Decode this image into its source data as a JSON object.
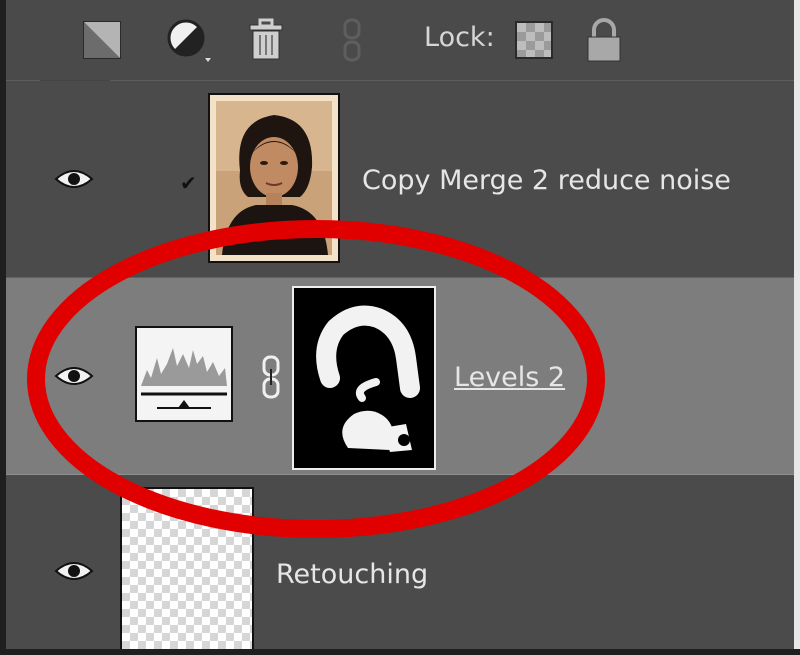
{
  "toolbar": {
    "lock_label": "Lock:",
    "icons": [
      "new-layer-icon",
      "adjustment-layer-icon",
      "delete-layer-icon",
      "link-layers-icon",
      "lock-transparent-icon",
      "lock-all-icon"
    ]
  },
  "layers": [
    {
      "name": "Copy Merge 2 reduce noise",
      "visible": true,
      "selected": false
    },
    {
      "name": "Levels 2",
      "visible": true,
      "selected": true
    },
    {
      "name": "Retouching",
      "visible": true,
      "selected": false
    }
  ],
  "colors": {
    "panel_bg": "#494949",
    "selected_row": "#7d7d7d",
    "annotation_ellipse": "#e00000",
    "text": "#e6e6e6"
  }
}
